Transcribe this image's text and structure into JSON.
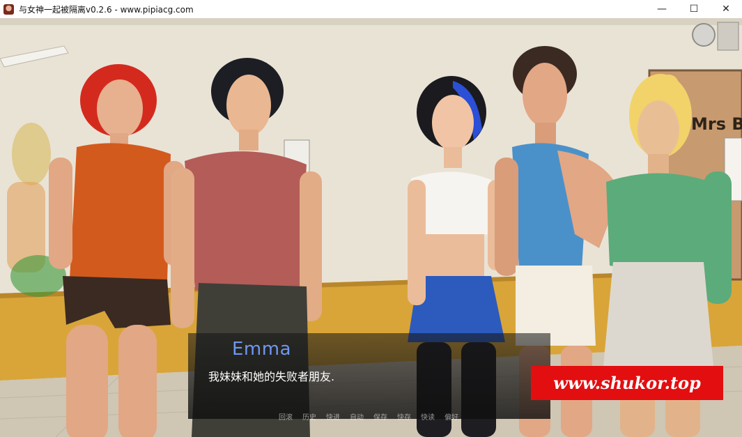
{
  "window": {
    "title": "与女神一起被隔离v0.2.6 - www.pipiacg.com",
    "minimize_glyph": "—",
    "maximize_glyph": "☐",
    "close_glyph": "✕"
  },
  "scene": {
    "door_sign_text": "Mrs Be"
  },
  "dialogue": {
    "speaker": "Emma",
    "text": "我妹妹和她的失败者朋友."
  },
  "quick_menu": {
    "items": [
      "回滚",
      "历史",
      "快进",
      "自动",
      "保存",
      "快存",
      "快读",
      "偏好"
    ]
  },
  "watermark": {
    "text": "www.shukor.top"
  },
  "colors": {
    "speaker": "#6f97f2",
    "watermark_bg": "#e30e10",
    "wall": "#e9e3d6",
    "wainscot": "#d9a539"
  }
}
